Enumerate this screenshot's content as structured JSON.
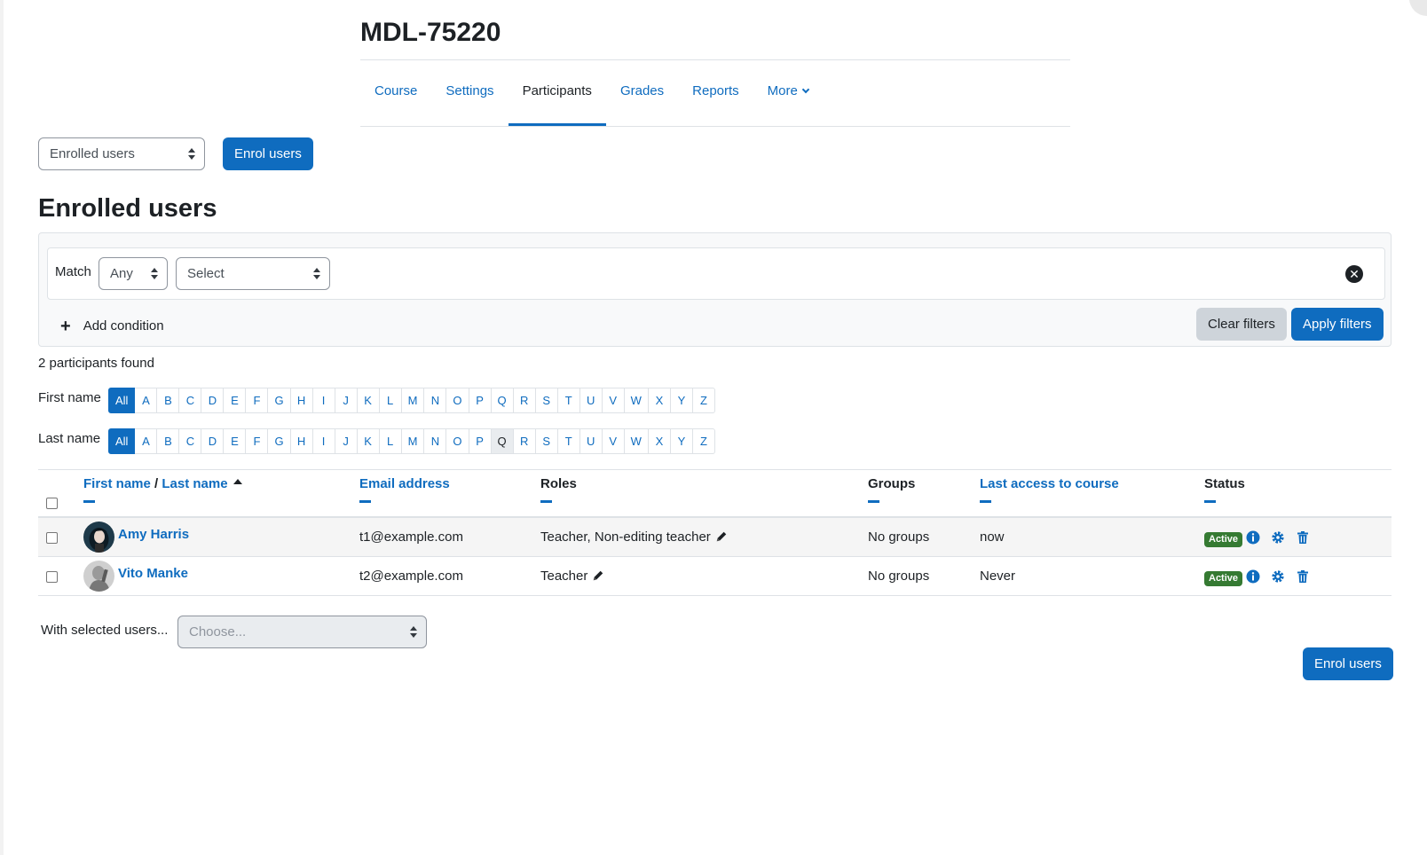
{
  "header": {
    "title": "MDL-75220",
    "tabs": [
      {
        "label": "Course"
      },
      {
        "label": "Settings"
      },
      {
        "label": "Participants"
      },
      {
        "label": "Grades"
      },
      {
        "label": "Reports"
      },
      {
        "label": "More"
      }
    ],
    "active_tab": "Participants"
  },
  "toolbar": {
    "view_select": "Enrolled users",
    "enrol_button": "Enrol users"
  },
  "section_title": "Enrolled users",
  "filters": {
    "match_label": "Match",
    "match_value": "Any",
    "type_select": "Select",
    "add_condition": "Add condition",
    "clear_button": "Clear filters",
    "apply_button": "Apply filters"
  },
  "participants_found": "2 participants found",
  "initials_bar": {
    "first_label": "First name",
    "last_label": "Last name",
    "letters": [
      "All",
      "A",
      "B",
      "C",
      "D",
      "E",
      "F",
      "G",
      "H",
      "I",
      "J",
      "K",
      "L",
      "M",
      "N",
      "O",
      "P",
      "Q",
      "R",
      "S",
      "T",
      "U",
      "V",
      "W",
      "X",
      "Y",
      "Z"
    ],
    "first_selected": "All",
    "last_selected": "All",
    "last_hovered": "Q"
  },
  "table": {
    "headers": {
      "first_name": "First name",
      "separator": " / ",
      "last_name": "Last name",
      "email": "Email address",
      "roles": "Roles",
      "groups": "Groups",
      "last_access": "Last access to course",
      "status": "Status"
    },
    "rows": [
      {
        "name": "Amy Harris",
        "email": "t1@example.com",
        "roles": "Teacher, Non-editing teacher",
        "groups": "No groups",
        "last_access": "now",
        "status": "Active"
      },
      {
        "name": "Vito Manke",
        "email": "t2@example.com",
        "roles": "Teacher",
        "groups": "No groups",
        "last_access": "Never",
        "status": "Active"
      }
    ]
  },
  "bulk": {
    "label": "With selected users...",
    "placeholder": "Choose...",
    "enrol_button": "Enrol users"
  },
  "colors": {
    "primary": "#0f6cbf",
    "active_badge": "#357a32",
    "text": "#1d2125"
  }
}
